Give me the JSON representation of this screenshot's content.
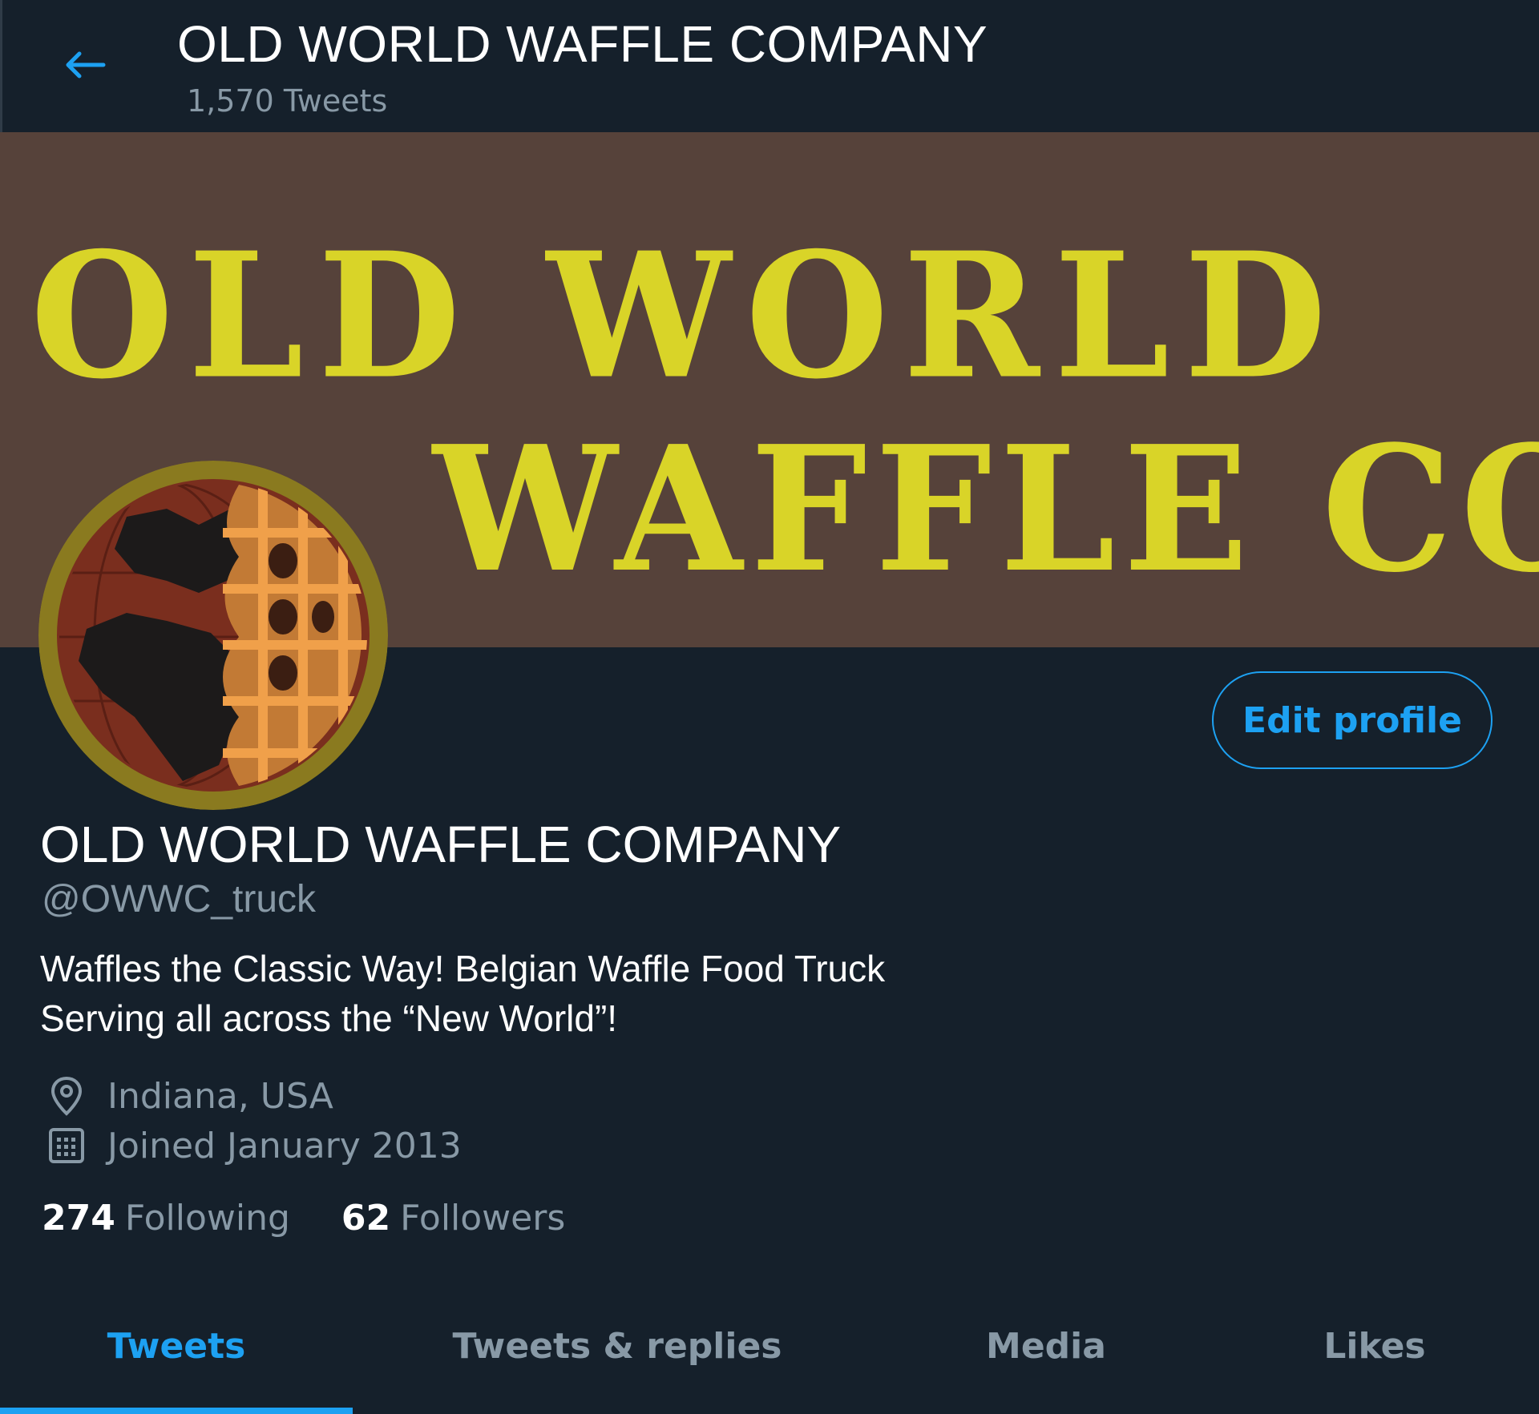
{
  "header": {
    "title": "OLD WORLD WAFFLE COMPANY",
    "tweet_count": "1,570 Tweets"
  },
  "banner": {
    "brand_name": "OLD WORLD WAFFLE COMPANY",
    "background_color": "#56423a",
    "logo_color": "#d9d428"
  },
  "profile": {
    "name": "OLD WORLD WAFFLE COMPANY",
    "handle": "@OWWC_truck",
    "bio_line1": "Waffles the Classic Way! Belgian Waffle Food Truck",
    "bio_line2": "Serving all across the “New World”!",
    "location": "Indiana, USA",
    "joined": "Joined January 2013",
    "following_count": "274",
    "following_label": "Following",
    "followers_count": "62",
    "followers_label": "Followers",
    "edit_button": "Edit profile"
  },
  "tabs": [
    {
      "label": "Tweets",
      "active": true
    },
    {
      "label": "Tweets & replies",
      "active": false
    },
    {
      "label": "Media",
      "active": false
    },
    {
      "label": "Likes",
      "active": false
    }
  ],
  "icons": {
    "back": "arrow-left-icon",
    "location": "location-pin-icon",
    "calendar": "calendar-icon"
  },
  "colors": {
    "background": "#15202b",
    "accent": "#1da1f2",
    "secondary_text": "#8899a6"
  }
}
